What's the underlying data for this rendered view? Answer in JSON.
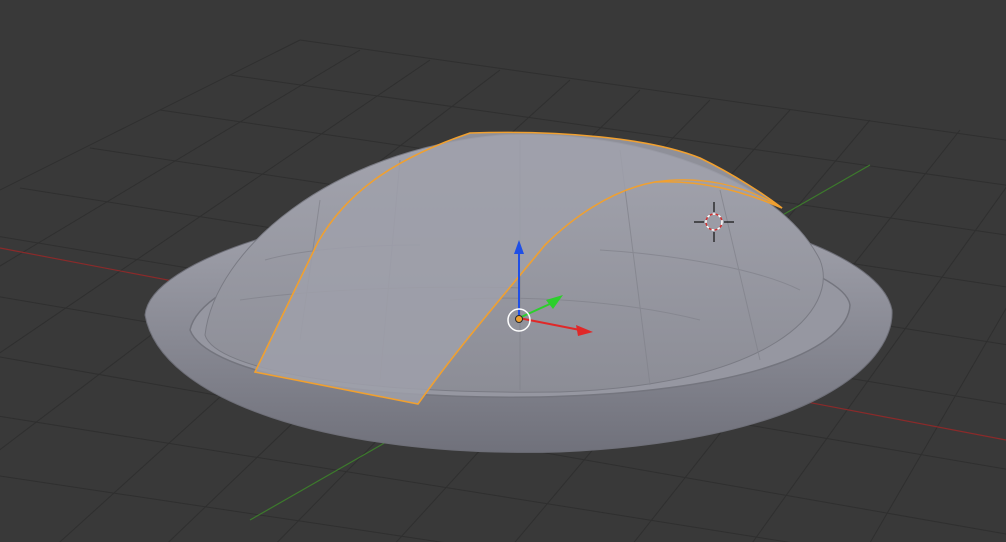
{
  "viewport": {
    "background": "#393939",
    "grid_color": "#2f2f2f",
    "x_axis_color": "#8a2a2a",
    "y_axis_color": "#3c7a2c"
  },
  "object": {
    "type": "dome-mesh",
    "surface_color": "#8f9098",
    "selection_outline_color": "#f0a030"
  },
  "gizmo": {
    "x_axis_color": "#e02828",
    "y_axis_color": "#2ccf2c",
    "z_axis_color": "#1f4fe6",
    "origin_color": "#f0a030"
  },
  "cursor_3d": {
    "icon": "crosshair-icon",
    "color": "#d03030"
  }
}
